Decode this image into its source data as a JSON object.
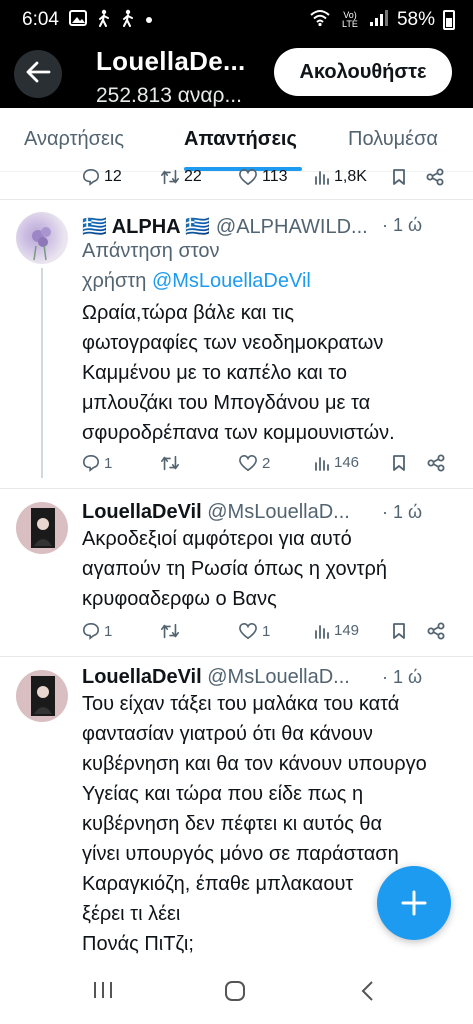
{
  "status_bar": {
    "time": "6:04",
    "network": "Vo) LTE",
    "signal_gen": "5",
    "battery": "58%"
  },
  "header": {
    "title": "LouellaDe...",
    "subtitle": "252.813 αναρ...",
    "follow_label": "Ακολουθήστε"
  },
  "tabs": [
    {
      "label": "Αναρτήσεις",
      "active": false
    },
    {
      "label": "Απαντήσεις",
      "active": true
    },
    {
      "label": "Πολυμέσα",
      "active": false
    }
  ],
  "top_actions": {
    "replies": "12",
    "retweets": "22",
    "likes": "113",
    "views": "1,8K"
  },
  "tweets": [
    {
      "name": "🇬🇷 ALPHA 🇬🇷",
      "handle": "@ALPHAWILD...",
      "time": "· 1 ώ",
      "reply_to_prefix": "Απάντηση στον",
      "reply_to_line2": "χρήστη",
      "reply_to_mention": "@MsLouellaDeVil",
      "text_lines": [
        "Ωραία,τώρα βάλε και τις",
        "φωτογραφίες των νεοδημοκρατων",
        "Καμμένου με το καπέλο  και το",
        "μπλουζάκι του Μπογδάνου με τα",
        "σφυροδρέπανα των κομμουνιστών."
      ],
      "replies": "1",
      "retweets": "",
      "likes": "2",
      "views": "146"
    },
    {
      "name": "LouellaDeVil",
      "handle": "@MsLouellaD...",
      "time": "· 1 ώ",
      "text_lines": [
        "Ακροδεξιοί αμφότεροι για αυτό",
        "αγαπούν τη Ρωσία όπως η χοντρή",
        "κρυφοαδερφω ο Βανς"
      ],
      "replies": "1",
      "retweets": "",
      "likes": "1",
      "views": "149"
    },
    {
      "name": "LouellaDeVil",
      "handle": "@MsLouellaD...",
      "time": "· 1 ώ",
      "text_lines": [
        "Του είχαν τάξει του μαλάκα του κατά",
        "φαντασίαν γιατρού ότι θα κάνουν",
        "κυβέρνηση και θα τον κάνουν υπουργο",
        "Υγείας και τώρα που είδε πως η",
        "κυβέρνηση δεν πέφτει κι αυτός θα",
        "γίνει υπουργός μόνο σε παράσταση",
        "Καραγκιόζη, έπαθε μπλακαουτ",
        "ξέρει τι λέει",
        "Πονάς ΠιΤζι;"
      ]
    }
  ],
  "colors": {
    "accent": "#1d9bf0",
    "secondary_text": "#536471",
    "primary_text": "#0f1419"
  }
}
